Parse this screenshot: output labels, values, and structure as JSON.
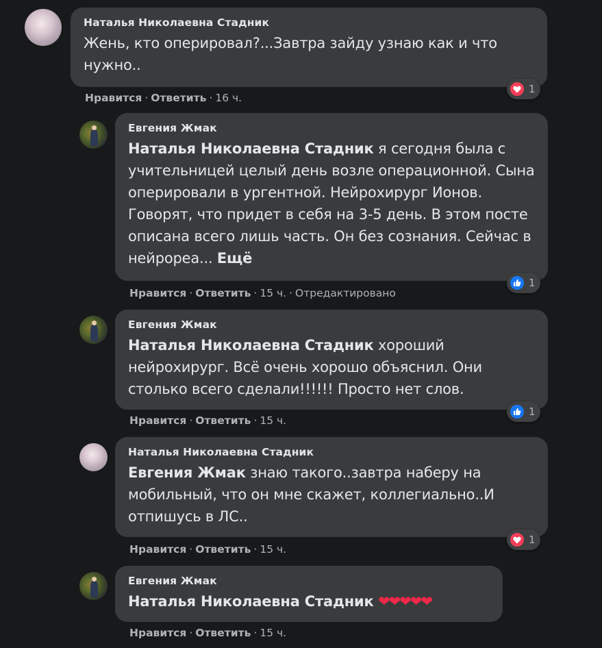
{
  "actions": {
    "like": "Нравится",
    "reply": "Ответить",
    "separator": "·"
  },
  "comments": [
    {
      "author": "Наталья Николаевна Стадник",
      "text": "Жень, кто оперировал?...Завтра зайду узнаю как и что нужно..",
      "time": "16 ч.",
      "reaction": {
        "type": "love",
        "icon": "heart-icon",
        "count": "1"
      }
    },
    {
      "author": "Евгения Жмак",
      "mention": "Наталья Николаевна Стадник",
      "text": " я сегодня была с учительницей целый день возле операционной. Сына оперировали в ургентной. Нейрохирург Ионов. Говорят, что придет в себя на 3-5 день. В этом посте описана всего лишь часть. Он без сознания. Сейчас в нейрореа... ",
      "more": "Ещё",
      "time": "15 ч.",
      "edited": "Отредактировано",
      "reaction": {
        "type": "like",
        "icon": "thumbs-up-icon",
        "count": "1"
      }
    },
    {
      "author": "Евгения Жмак",
      "mention": "Наталья Николаевна Стадник",
      "text": " хороший нейрохирург. Всё очень хорошо объяснил. Они столько всего сделали!!!!!! Просто нет слов.",
      "time": "15 ч.",
      "reaction": {
        "type": "like",
        "icon": "thumbs-up-icon",
        "count": "1"
      }
    },
    {
      "author": "Наталья Николаевна Стадник",
      "mention": "Евгения Жмак",
      "text": " знаю такого..завтра наберу на мобильный, что он мне скажет, коллегиально..И отпишусь в ЛС..",
      "time": "15 ч.",
      "reaction": {
        "type": "love",
        "icon": "heart-icon",
        "count": "1"
      }
    },
    {
      "author": "Евгения Жмак",
      "mention": "Наталья Николаевна Стадник",
      "text": " ",
      "emoji": "❤❤❤❤❤",
      "time": "15 ч."
    }
  ],
  "colors": {
    "background": "#18191a",
    "bubble": "#3a3b3c",
    "love": "#f33e58",
    "like": "#1877f2"
  }
}
